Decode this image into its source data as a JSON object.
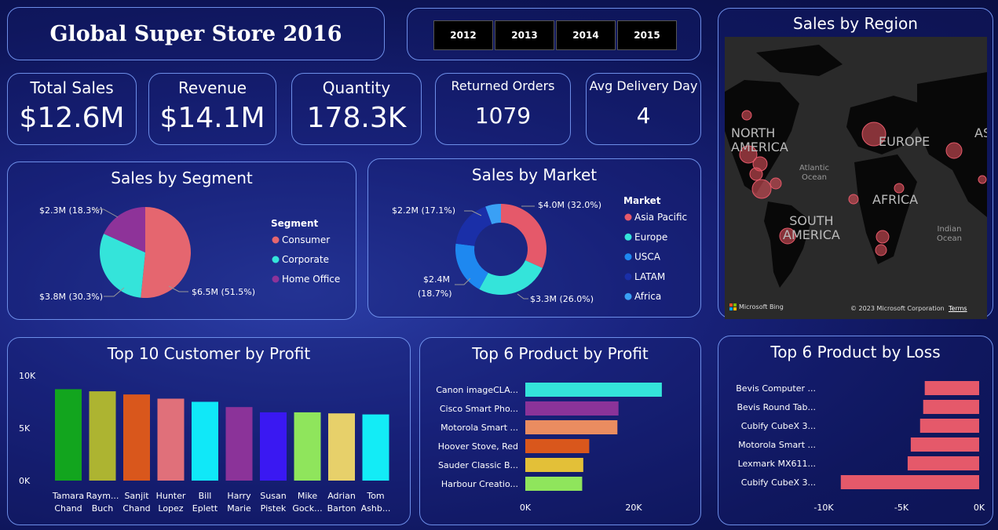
{
  "header": {
    "title": "Global Super Store 2016"
  },
  "years": [
    "2012",
    "2013",
    "2014",
    "2015"
  ],
  "kpis": {
    "total_sales": {
      "label": "Total Sales",
      "value": "$12.6M"
    },
    "revenue": {
      "label": "Revenue",
      "value": "$14.1M"
    },
    "quantity": {
      "label": "Quantity",
      "value": "178.3K"
    },
    "returned": {
      "label": "Returned Orders",
      "value": "1079"
    },
    "delivery": {
      "label": "Avg Delivery Day",
      "value": "4"
    }
  },
  "segment": {
    "title": "Sales by Segment",
    "legend_title": "Segment",
    "labels": {
      "consumer": "$6.5M (51.5%)",
      "corporate": "$3.8M (30.3%)",
      "home_office": "$2.3M (18.3%)"
    }
  },
  "market": {
    "title": "Sales by Market",
    "legend_title": "Market",
    "labels": {
      "asia": "$4.0M (32.0%)",
      "europe": "$3.3M (26.0%)",
      "usca_1": "$2.4M",
      "usca_2": "(18.7%)",
      "latam": "$2.2M (17.1%)"
    }
  },
  "region": {
    "title": "Sales by Region",
    "labels": {
      "north_america_1": "NORTH",
      "north_america_2": "AMERICA",
      "europe": "EUROPE",
      "asia": "ASI",
      "atlantic_1": "Atlantic",
      "atlantic_2": "Ocean",
      "africa": "AFRICA",
      "south_america_1": "SOUTH",
      "south_america_2": "AMERICA",
      "indian_1": "Indian",
      "indian_2": "Ocean"
    },
    "brand": "Microsoft Bing",
    "copyright": "© 2023 Microsoft Corporation",
    "terms": "Terms"
  },
  "customers": {
    "title": "Top 10 Customer by Profit",
    "yticks": [
      "10K",
      "5K",
      "0K"
    ]
  },
  "products_profit": {
    "title": "Top 6 Product by Profit",
    "xticks": [
      "0K",
      "20K"
    ]
  },
  "products_loss": {
    "title": "Top 6 Product by Loss",
    "xticks": [
      "-10K",
      "-5K",
      "0K"
    ]
  },
  "chart_data": [
    {
      "type": "pie",
      "title": "Sales by Segment",
      "legend": "Segment",
      "categories": [
        "Consumer",
        "Corporate",
        "Home Office"
      ],
      "values": [
        6.5,
        3.8,
        2.3
      ],
      "percent": [
        51.5,
        30.3,
        18.3
      ],
      "unit": "$M",
      "colors": [
        "#e5666f",
        "#34e4da",
        "#8e3399"
      ]
    },
    {
      "type": "pie",
      "donut": true,
      "title": "Sales by Market",
      "legend": "Market",
      "categories": [
        "Asia Pacific",
        "Europe",
        "USCA",
        "LATAM",
        "Africa"
      ],
      "values": [
        4.0,
        3.3,
        2.4,
        2.2,
        0.7
      ],
      "percent": [
        32.0,
        26.0,
        18.7,
        17.1,
        5.6
      ],
      "unit": "$M",
      "colors": [
        "#e5596a",
        "#34e4da",
        "#1e88f0",
        "#1a2fa8",
        "#3aa0f5"
      ]
    },
    {
      "type": "bar",
      "title": "Top 10 Customer by Profit",
      "categories": [
        [
          "Tamara",
          "Chand"
        ],
        [
          "Raym...",
          "Buch"
        ],
        [
          "Sanjit",
          "Chand"
        ],
        [
          "Hunter",
          "Lopez"
        ],
        [
          "Bill",
          "Eplett"
        ],
        [
          "Harry",
          "Marie"
        ],
        [
          "Susan",
          "Pistek"
        ],
        [
          "Mike",
          "Gock..."
        ],
        [
          "Adrian",
          "Barton"
        ],
        [
          "Tom",
          "Ashb..."
        ]
      ],
      "values": [
        8700,
        8500,
        8200,
        7800,
        7500,
        7000,
        6500,
        6500,
        6400,
        6300
      ],
      "ylim": [
        0,
        10000
      ],
      "colors": [
        "#12a51e",
        "#adb431",
        "#d9571c",
        "#e0707a",
        "#10e8f8",
        "#8b3399",
        "#3a18f2",
        "#8fe55c",
        "#e7d06a",
        "#13ecf6"
      ]
    },
    {
      "type": "bar",
      "orientation": "horizontal",
      "title": "Top 6 Product by Profit",
      "categories": [
        "Canon imageCLA...",
        "Cisco Smart Pho...",
        "Motorola Smart ...",
        "Hoover Stove, Red",
        "Sauder Classic B...",
        "Harbour Creatio..."
      ],
      "values": [
        25200,
        17200,
        17000,
        11800,
        10700,
        10500
      ],
      "xlim": [
        0,
        30000
      ],
      "colors": [
        "#34e4da",
        "#8b3399",
        "#ea8c60",
        "#d9571c",
        "#e3c038",
        "#8fe55c"
      ]
    },
    {
      "type": "bar",
      "orientation": "horizontal",
      "title": "Top 6 Product by Loss",
      "categories": [
        "Bevis Computer ...",
        "Bevis Round Tab...",
        "Cubify CubeX 3...",
        "Motorola Smart ...",
        "Lexmark MX611...",
        "Cubify CubeX 3..."
      ],
      "values": [
        -3500,
        -3600,
        -3800,
        -4400,
        -4600,
        -8900
      ],
      "xlim": [
        -11000,
        0
      ],
      "colors": [
        "#e5596a",
        "#e5596a",
        "#e5596a",
        "#e5596a",
        "#e5596a",
        "#e5596a"
      ]
    }
  ]
}
